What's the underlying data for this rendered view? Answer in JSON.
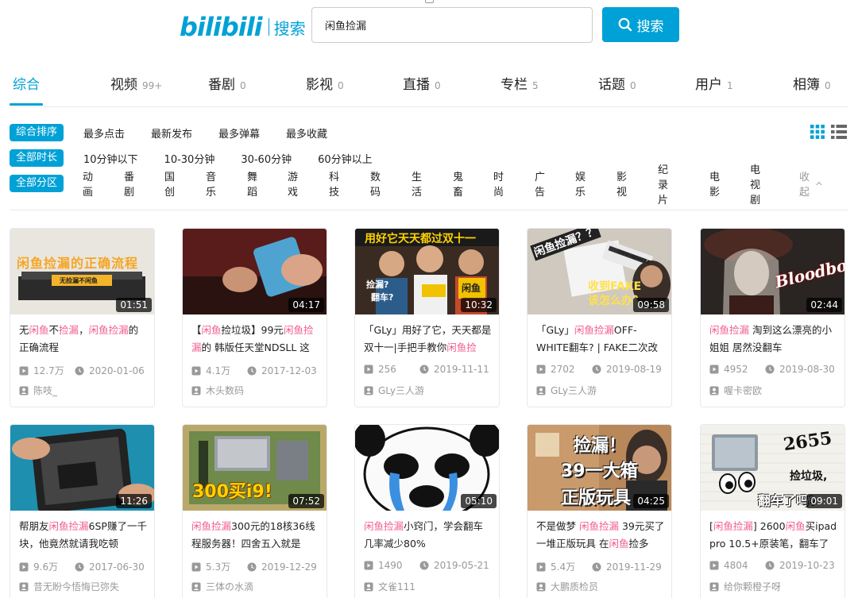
{
  "header": {
    "logo_text": "bilibili",
    "logo_sub": "搜索",
    "search_value": "闲鱼捡漏",
    "search_button": "搜索"
  },
  "tabs": [
    {
      "label": "综合",
      "count": ""
    },
    {
      "label": "视频",
      "count": "99+"
    },
    {
      "label": "番剧",
      "count": "0"
    },
    {
      "label": "影视",
      "count": "0"
    },
    {
      "label": "直播",
      "count": "0"
    },
    {
      "label": "专栏",
      "count": "5"
    },
    {
      "label": "话题",
      "count": "0"
    },
    {
      "label": "用户",
      "count": "1"
    },
    {
      "label": "相簿",
      "count": "0"
    }
  ],
  "filters": {
    "order": {
      "selected": "综合排序",
      "options": [
        "最多点击",
        "最新发布",
        "最多弹幕",
        "最多收藏"
      ]
    },
    "duration": {
      "selected": "全部时长",
      "options": [
        "10分钟以下",
        "10-30分钟",
        "30-60分钟",
        "60分钟以上"
      ]
    },
    "zone": {
      "selected": "全部分区",
      "options": [
        "动画",
        "番剧",
        "国创",
        "音乐",
        "舞蹈",
        "游戏",
        "科技",
        "数码",
        "生活",
        "鬼畜",
        "时尚",
        "广告",
        "娱乐",
        "影视",
        "纪录片",
        "电影",
        "电视剧"
      ],
      "collapse": "收起"
    }
  },
  "thumb_texts": {
    "v1": "闲鱼捡漏的正确流程",
    "v1b": "无捡漏不闲鱼",
    "v3": "用好它天天都过双十一",
    "v3b": "捡漏?",
    "v3c": "翻车?",
    "v3d": "闲鱼",
    "v4": "闲鱼捡漏？？",
    "v4b": "收到FAKE",
    "v4c": "该怎么办？",
    "v4d": "OFF-WHITE",
    "v5": "Bloodborne",
    "v7": "300买i9!",
    "v9": "捡漏！",
    "v9b": "39一大箱",
    "v9c": "正版玩具",
    "v10": "2655",
    "v10b": "捡垃圾,",
    "v10c": "翻车了吗?"
  },
  "videos": [
    {
      "duration": "01:51",
      "views": "12.7万",
      "date": "2020-01-06",
      "uploader": "陈吱_",
      "title_parts": [
        "无",
        "闲鱼",
        "不",
        "捡漏",
        "，",
        "闲鱼捡漏",
        "的正确流程"
      ]
    },
    {
      "duration": "04:17",
      "views": "4.1万",
      "date": "2017-12-03",
      "uploader": "木头数码",
      "title_parts": [
        "【",
        "闲鱼",
        "捡垃圾】99元",
        "闲鱼捡漏",
        "的 韩版任天堂NDSLL 这"
      ]
    },
    {
      "duration": "10:32",
      "views": "256",
      "date": "2019-11-11",
      "uploader": "GLy三人游",
      "title_parts": [
        "「GLy」用好了它，天天都是双十一|手把手教你",
        "闲鱼捡",
        ""
      ]
    },
    {
      "duration": "09:58",
      "views": "2702",
      "date": "2019-08-19",
      "uploader": "GLy三人游",
      "title_parts": [
        "「GLy」",
        "闲鱼捡漏",
        "OFF-WHITE翻车? | FAKE二次改"
      ]
    },
    {
      "duration": "02:44",
      "views": "4952",
      "date": "2019-08-30",
      "uploader": "喔卡密欧",
      "title_parts": [
        "",
        "闲鱼捡漏",
        " 淘到这么漂亮的小姐姐 居然没翻车"
      ]
    },
    {
      "duration": "11:26",
      "views": "9.6万",
      "date": "2017-06-30",
      "uploader": "昔无盼今悟悔已弥失",
      "title_parts": [
        "帮朋友",
        "闲鱼捡漏",
        "6SP赚了一千块，他竟然就请我吃顿"
      ]
    },
    {
      "duration": "07:52",
      "views": "5.3万",
      "date": "2019-12-29",
      "uploader": "三体の水滴",
      "title_parts": [
        "",
        "闲鱼捡漏",
        "300元的18核36线程服务器！四舍五入就是"
      ]
    },
    {
      "duration": "05:10",
      "views": "1490",
      "date": "2019-05-21",
      "uploader": "文雀111",
      "title_parts": [
        "",
        "闲鱼捡漏",
        "小窍门，学会翻车几率减少80%"
      ]
    },
    {
      "duration": "04:25",
      "views": "5.4万",
      "date": "2019-11-29",
      "uploader": "大鹏质检员",
      "title_parts": [
        "不是做梦 ",
        "闲鱼捡漏",
        " 39元买了一堆正版玩具 在",
        "闲鱼",
        "捡多"
      ]
    },
    {
      "duration": "09:01",
      "views": "4804",
      "date": "2019-10-23",
      "uploader": "给你颗橙子呀",
      "title_parts": [
        "[",
        "闲鱼捡漏",
        "] 2600",
        "闲鱼",
        "买ipad pro 10.5+原装笔，翻车了"
      ]
    }
  ],
  "colors": {
    "accent": "#00a1d6",
    "highlight": "#f25d8e",
    "meta": "#999999"
  }
}
